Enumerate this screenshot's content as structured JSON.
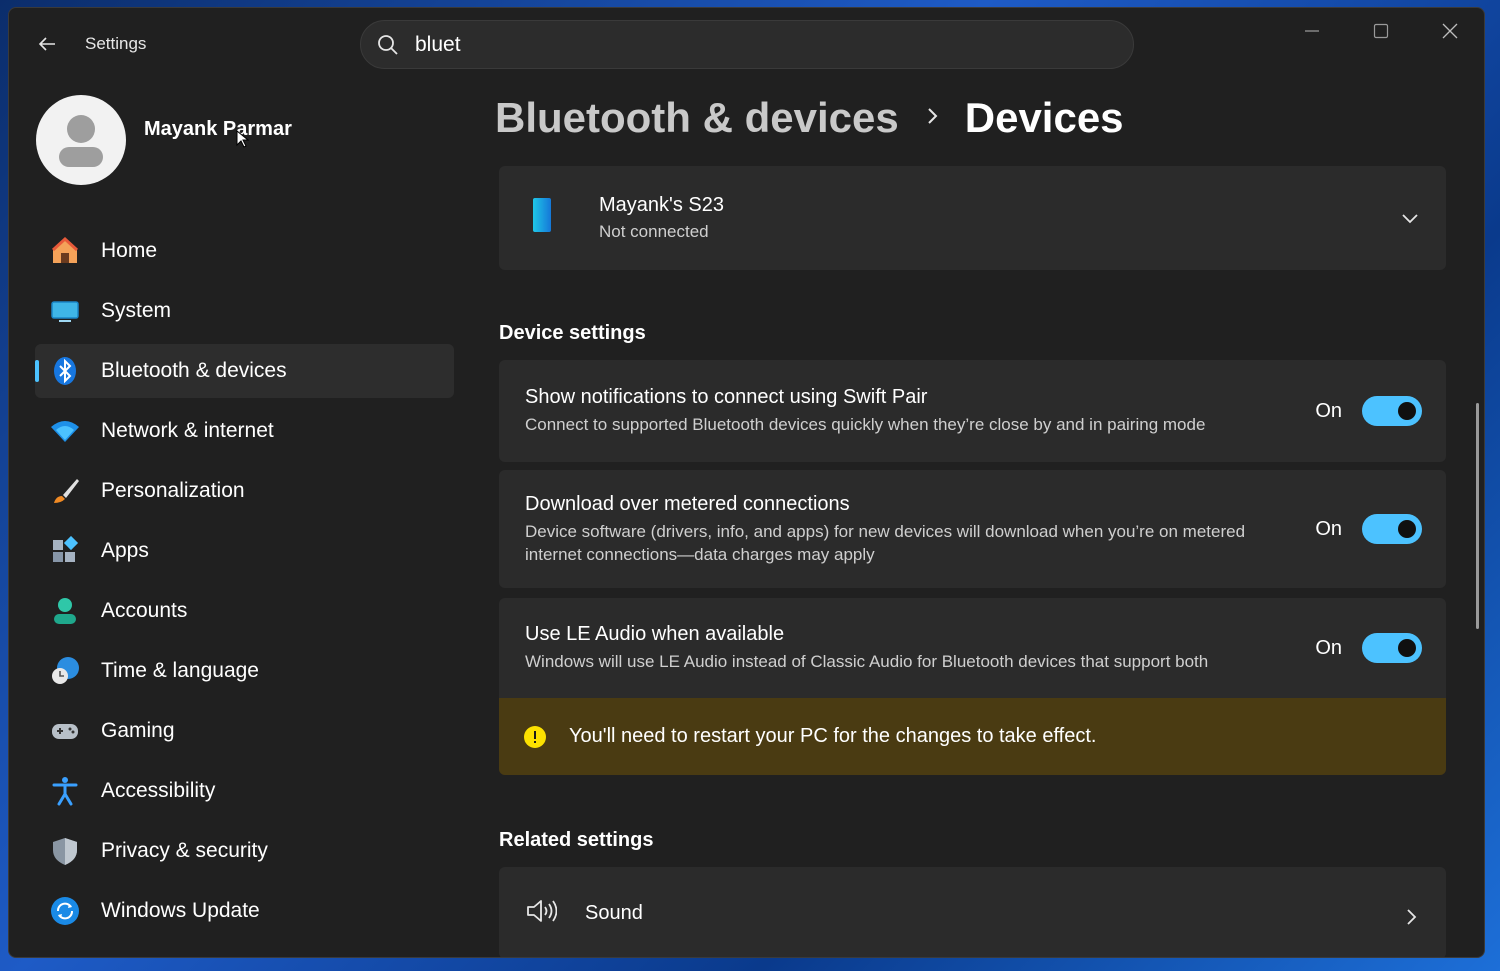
{
  "window": {
    "title": "Settings",
    "search_value": "bluet"
  },
  "user": {
    "name": "Mayank Parmar"
  },
  "sidebar": {
    "items": [
      {
        "label": "Home",
        "icon": "home-icon"
      },
      {
        "label": "System",
        "icon": "system-icon"
      },
      {
        "label": "Bluetooth & devices",
        "icon": "bluetooth-icon",
        "active": true
      },
      {
        "label": "Network & internet",
        "icon": "wifi-icon"
      },
      {
        "label": "Personalization",
        "icon": "brush-icon"
      },
      {
        "label": "Apps",
        "icon": "apps-icon"
      },
      {
        "label": "Accounts",
        "icon": "account-icon"
      },
      {
        "label": "Time & language",
        "icon": "clock-globe-icon"
      },
      {
        "label": "Gaming",
        "icon": "gamepad-icon"
      },
      {
        "label": "Accessibility",
        "icon": "accessibility-icon"
      },
      {
        "label": "Privacy & security",
        "icon": "shield-icon"
      },
      {
        "label": "Windows Update",
        "icon": "update-icon"
      }
    ]
  },
  "breadcrumb": {
    "parent": "Bluetooth & devices",
    "current": "Devices"
  },
  "device": {
    "name": "Mayank's S23",
    "status": "Not connected"
  },
  "device_settings": {
    "title": "Device settings",
    "items": [
      {
        "title": "Show notifications to connect using Swift Pair",
        "description": "Connect to supported Bluetooth devices quickly when they’re close by and in pairing mode",
        "state": "On"
      },
      {
        "title": "Download over metered connections",
        "description": "Device software (drivers, info, and apps) for new devices will download when you’re on metered internet connections—data charges may apply",
        "state": "On"
      },
      {
        "title": "Use LE Audio when available",
        "description": "Windows will use LE Audio instead of Classic Audio for Bluetooth devices that support both",
        "state": "On"
      }
    ],
    "warning": "You'll need to restart your PC for the changes to take effect."
  },
  "related_settings": {
    "title": "Related settings",
    "items": [
      {
        "label": "Sound",
        "icon": "speaker-icon"
      }
    ]
  },
  "colors": {
    "accent": "#4cc2ff",
    "window_bg": "#202020",
    "card_bg": "#2b2b2b",
    "warning_bg": "#4a3b12"
  }
}
